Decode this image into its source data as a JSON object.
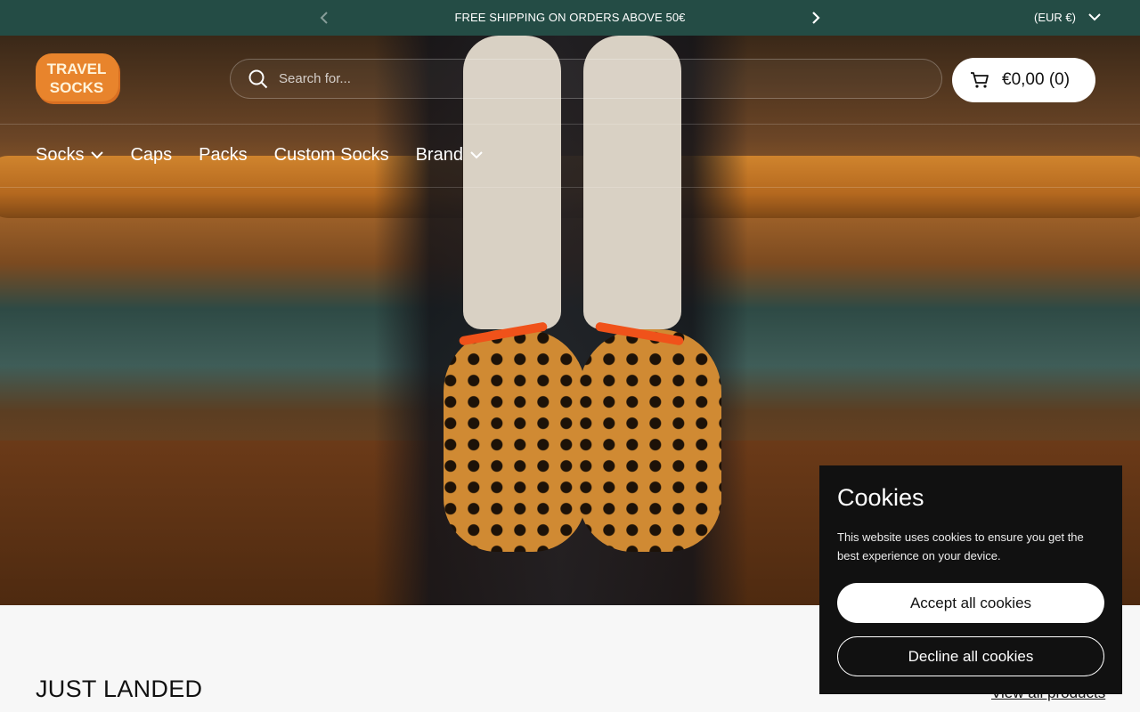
{
  "announcement": {
    "message": "FREE SHIPPING ON ORDERS ABOVE 50€",
    "currency": "(EUR €)",
    "prev_icon": "chevron-left-icon",
    "next_icon": "chevron-right-icon"
  },
  "header": {
    "logo_text_line1": "TRAVEL",
    "logo_text_line2": "SOCKS",
    "search_placeholder": "Search for...",
    "cart_label": "€0,00 (0)"
  },
  "nav": {
    "items": [
      {
        "label": "Socks",
        "has_dropdown": true
      },
      {
        "label": "Caps",
        "has_dropdown": false
      },
      {
        "label": "Packs",
        "has_dropdown": false
      },
      {
        "label": "Custom Socks",
        "has_dropdown": false
      },
      {
        "label": "Brand",
        "has_dropdown": true
      }
    ]
  },
  "section": {
    "title": "JUST LANDED",
    "view_all": "View all products"
  },
  "cookies": {
    "title": "Cookies",
    "text": "This website uses cookies to ensure you get the best experience on your device.",
    "accept": "Accept all cookies",
    "decline": "Decline all cookies"
  },
  "colors": {
    "announcement_bg": "#244c45",
    "logo": "#e6822a",
    "cookie_bg": "#111111"
  }
}
